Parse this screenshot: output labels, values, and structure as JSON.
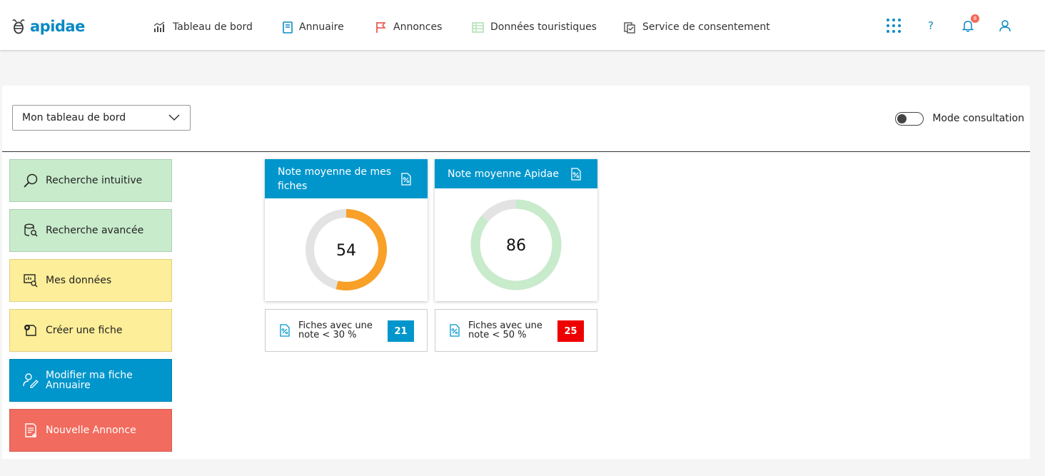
{
  "header": {
    "logo_text": "apidae",
    "nav": [
      {
        "label": "Tableau de bord",
        "icon": "chart-icon"
      },
      {
        "label": "Annuaire",
        "icon": "book-icon"
      },
      {
        "label": "Annonces",
        "icon": "flag-icon"
      },
      {
        "label": "Données touristiques",
        "icon": "table-icon"
      },
      {
        "label": "Service de consentement",
        "icon": "consent-icon"
      }
    ],
    "help_label": "?",
    "notifications_count": "8"
  },
  "dashboard": {
    "selector_value": "Mon tableau de bord",
    "mode_label": "Mode consultation",
    "mode_enabled": false
  },
  "actions": [
    {
      "label": "Recherche intuitive",
      "icon": "search-icon"
    },
    {
      "label": "Recherche avancée",
      "icon": "database-search-icon"
    },
    {
      "label": "Mes données",
      "icon": "data-icon"
    },
    {
      "label": "Créer une fiche",
      "icon": "add-record-icon"
    },
    {
      "label": "Modifier ma fiche Annuaire",
      "icon": "edit-user-icon"
    },
    {
      "label": "Nouvelle Annonce",
      "icon": "new-announce-icon"
    }
  ],
  "score_cards": [
    {
      "title": "Note moyenne de mes fiches",
      "value": "54",
      "percent": 54,
      "color": "#f9a028",
      "track": "#e3e3e3"
    },
    {
      "title": "Note moyenne Apidae",
      "value": "86",
      "percent": 86,
      "color": "#c8ebcb",
      "track": "#e3e3e3"
    }
  ],
  "stats": [
    {
      "label": "Fiches avec une note < 30 %",
      "count": "21",
      "color": "#0096cc"
    },
    {
      "label": "Fiches avec une note < 50 %",
      "count": "25",
      "color": "#ee0000"
    }
  ],
  "colors": {
    "brand": "#0a8ac4",
    "tile_green": "#c8ebcb",
    "tile_yellow": "#fdee99",
    "tile_blue": "#0096cc",
    "tile_red": "#f16b5e"
  }
}
